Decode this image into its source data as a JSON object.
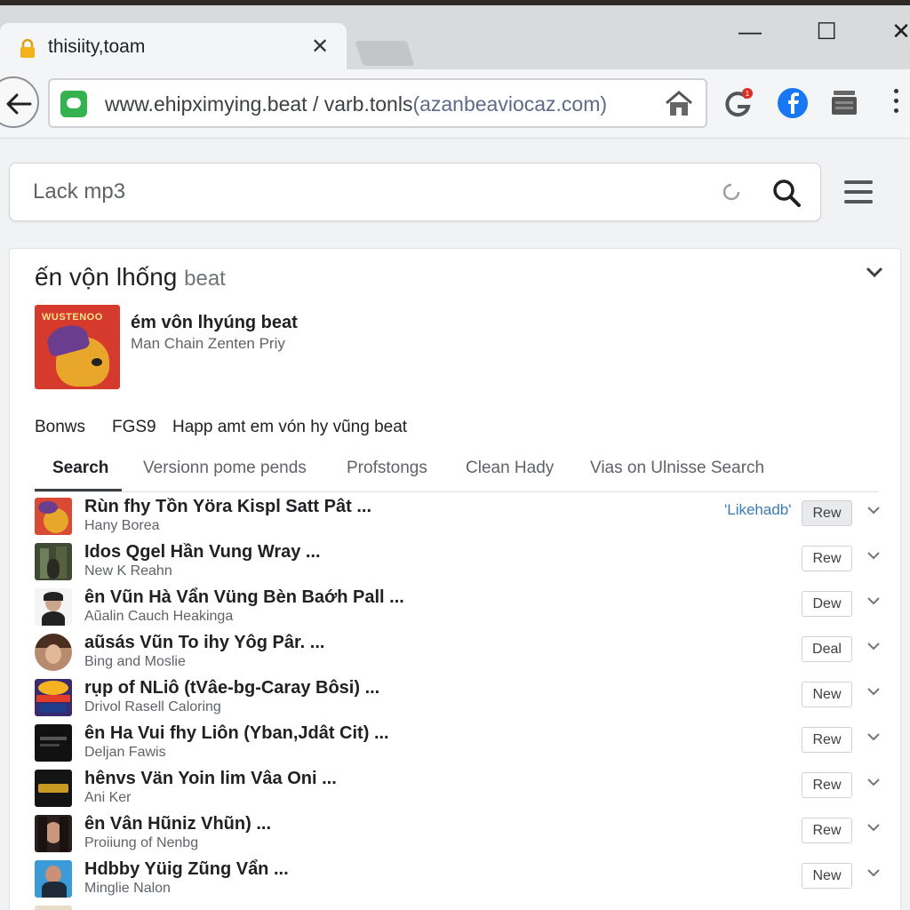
{
  "browser": {
    "tab_title": "thisiity,toam",
    "close_tab": "✕",
    "window_controls": {
      "minimize": "—",
      "maximize": "☐",
      "close": "✕"
    },
    "url_main": "www.ehipximying.beat / varb.tonls",
    "url_dim": "(azanbeaviocaz.com)",
    "extension_badge": "1"
  },
  "search": {
    "value": "Lack mp3"
  },
  "card": {
    "title": "ến vộn lhống",
    "title_suffix": "beat",
    "album_art_text": "WUSTENOO",
    "featured_title": "ém vôn lhyúng beat",
    "featured_subtitle": "Man Chain Zenten Priy",
    "meta": [
      "Bonws",
      "FGS9",
      "Happ amt em vón hy vũng beat"
    ],
    "tabs": [
      "Search",
      "Versionn pome pends",
      "Profstongs",
      "Clean Hady",
      "Vias on Ulnisse Search"
    ],
    "active_tab": "Search"
  },
  "results": [
    {
      "title": "Rùn fhy Tồn Yöra Kispl Satt Pât ...",
      "subtitle": "Hany Borea",
      "link": "'Likehadb'",
      "button": "Rew",
      "thumb": "cartoon"
    },
    {
      "title": "Idos Qgel Hần Vung Wray ...",
      "subtitle": "New K Reahn",
      "button": "Rew",
      "thumb": "forest"
    },
    {
      "title": "ên Vũn Hà Vẩn Vüng Bèn Baớh Pall ...",
      "subtitle": "Aũalin Cauch Heakinga",
      "button": "Dew",
      "thumb": "portrait-light"
    },
    {
      "title": "aũsás Vũn To ihy Yôg Pâr. ...",
      "subtitle": "Bing and Moslie",
      "button": "Deal",
      "thumb": "portrait-round"
    },
    {
      "title": "rụp of NLiô (tVâe-bg-Caray Bôsi) ...",
      "subtitle": "Drivol Rasell Caloring",
      "button": "New",
      "thumb": "concert"
    },
    {
      "title": "ên Ha Vui fhy Liôn (Yban,Jdât Cit) ...",
      "subtitle": "Deljan Fawis",
      "button": "Rew",
      "thumb": "dark"
    },
    {
      "title": "hênvs Vän Yoin lim Vâa Oni ...",
      "subtitle": "Ani Ker",
      "button": "Rew",
      "thumb": "gold"
    },
    {
      "title": "ên Vân Hũniz Vhũn) ...",
      "subtitle": "Proiiung of Nenbg",
      "button": "Rew",
      "thumb": "portrait-dark"
    },
    {
      "title": "Hdbby Yüig Zũng Vẩn ...",
      "subtitle": "Minglie Nalon",
      "button": "New",
      "thumb": "blue"
    }
  ],
  "colors": {
    "accent_blue": "#1a73e8",
    "facebook_blue": "#1877f2",
    "site_green": "#33b24f",
    "album_red": "#d63a2c",
    "link_blue": "#3a7ab8"
  },
  "icons": {
    "lock": "lock-icon",
    "back": "back-arrow-icon",
    "home": "home-icon",
    "search": "search-icon",
    "menu": "menu-icon",
    "expand": "chevron-down-icon"
  }
}
